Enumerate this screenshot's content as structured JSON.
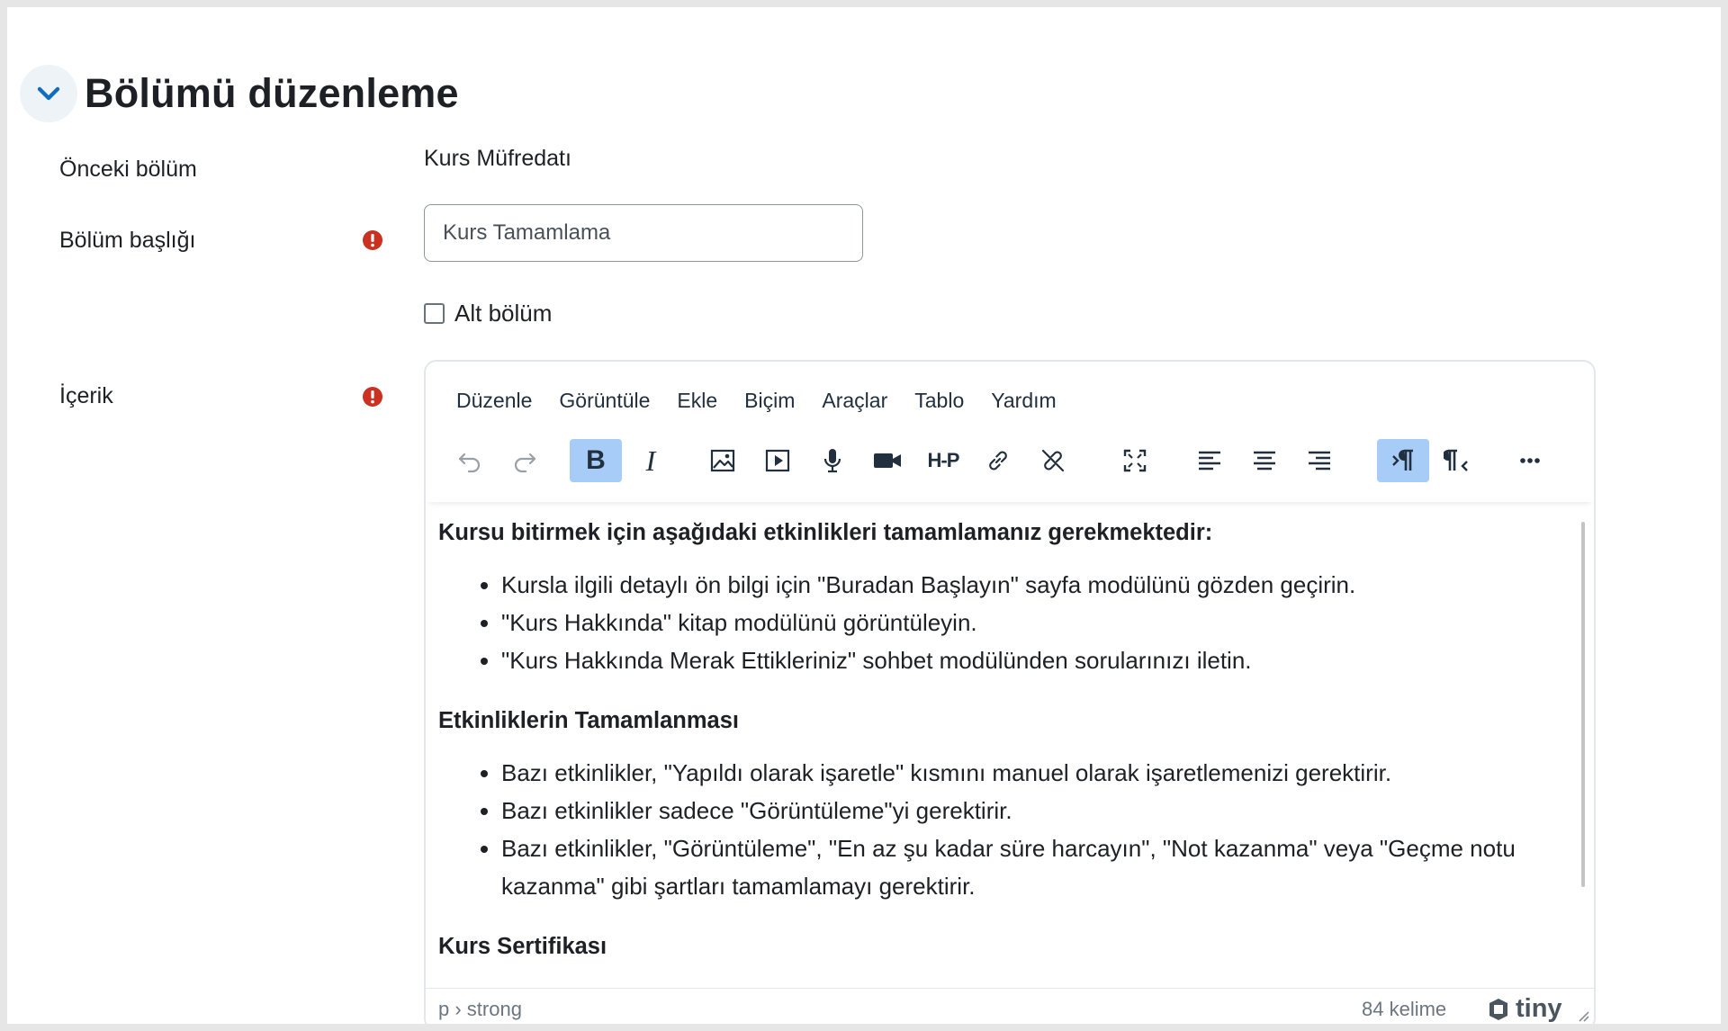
{
  "section": {
    "title": "Bölümü düzenleme"
  },
  "fields": {
    "previous_section": {
      "label": "Önceki bölüm",
      "value": "Kurs Müfredatı"
    },
    "section_title": {
      "label": "Bölüm başlığı",
      "value": "Kurs Tamamlama"
    },
    "subsection": {
      "label": "Alt bölüm",
      "checked": false
    },
    "content": {
      "label": "İçerik"
    }
  },
  "editor": {
    "menu": [
      "Düzenle",
      "Görüntüle",
      "Ekle",
      "Biçim",
      "Araçlar",
      "Tablo",
      "Yardım"
    ],
    "toolbar": {
      "icons": [
        "undo-icon",
        "redo-icon",
        "bold-icon",
        "italic-icon",
        "image-icon",
        "media-icon",
        "record-audio-icon",
        "record-video-icon",
        "h5p-icon",
        "link-icon",
        "unlink-icon",
        "fullscreen-icon",
        "align-left-icon",
        "align-center-icon",
        "align-right-icon",
        "ltr-icon",
        "rtl-icon",
        "more-icon"
      ],
      "bold_label": "B",
      "italic_label": "I",
      "h5p_label": "H-P"
    },
    "body": {
      "heading1": "Kursu bitirmek için aşağıdaki etkinlikleri tamamlamanız gerekmektedir:",
      "list1": [
        "Kursla ilgili detaylı ön bilgi için \"Buradan Başlayın\" sayfa modülünü gözden geçirin.",
        "\"Kurs Hakkında\" kitap modülünü görüntüleyin.",
        "\"Kurs Hakkında Merak Ettikleriniz\" sohbet modülünden sorularınızı iletin."
      ],
      "heading2": "Etkinliklerin Tamamlanması",
      "list2": [
        "Bazı etkinlikler, \"Yapıldı olarak işaretle\" kısmını manuel olarak işaretlemenizi gerektirir.",
        "Bazı etkinlikler sadece \"Görüntüleme\"yi gerektirir.",
        "Bazı etkinlikler, \"Görüntüleme\", \"En az şu kadar süre harcayın\", \"Not kazanma\" veya \"Geçme notu kazanma\" gibi şartları tamamlamayı gerektirir."
      ],
      "heading3": "Kurs Sertifikası"
    },
    "status": {
      "path": "p › strong",
      "word_count": "84 kelime",
      "brand": "tiny"
    }
  },
  "colors": {
    "accent": "#0f6cbf",
    "required": "#ca3120",
    "toolbar_active": "#a6ccf7"
  }
}
